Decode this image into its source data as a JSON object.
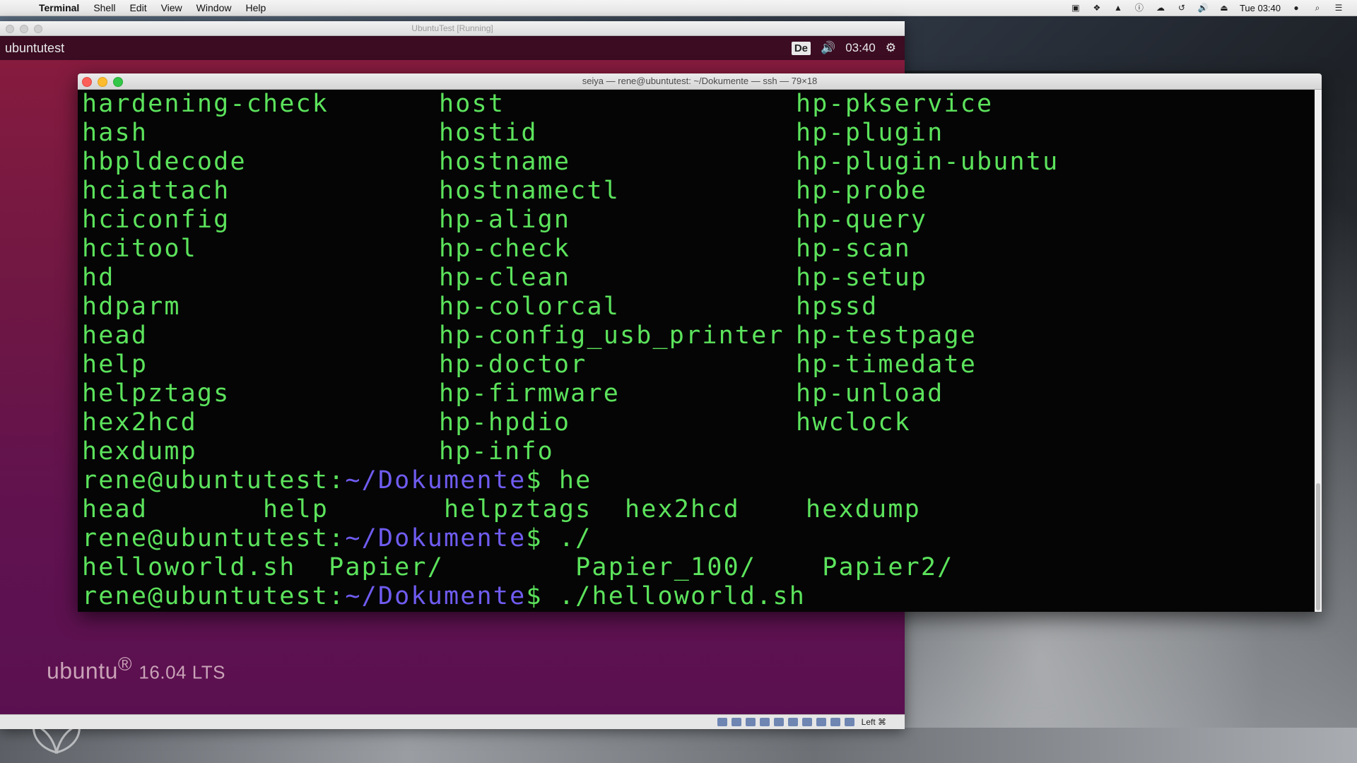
{
  "mac_menubar": {
    "app_name": "Terminal",
    "menus": [
      "Shell",
      "Edit",
      "View",
      "Window",
      "Help"
    ],
    "clock": "Tue 03:40",
    "tray_icons": [
      "screen-record-icon",
      "dropbox-icon",
      "google-drive-icon",
      "info-icon",
      "wifi-icon",
      "time-machine-icon",
      "volume-icon",
      "eject-icon",
      "user-icon",
      "spotlight-icon",
      "notification-center-icon"
    ]
  },
  "vbox": {
    "title": "UbuntuTest [Running]",
    "hostname": "ubuntutest",
    "keyboard_layout": "De",
    "time": "03:40",
    "brand": "ubuntu",
    "brand_mark": "®",
    "version": "16.04 LTS",
    "host_key": "Left ⌘"
  },
  "terminal": {
    "title": "seiya — rene@ubuntutest: ~/Dokumente — ssh — 79×18",
    "columns": [
      [
        "hardening-check",
        "hash",
        "hbpldecode",
        "hciattach",
        "hciconfig",
        "hcitool",
        "hd",
        "hdparm",
        "head",
        "help",
        "helpztags",
        "hex2hcd",
        "hexdump"
      ],
      [
        "host",
        "hostid",
        "hostname",
        "hostnamectl",
        "hp-align",
        "hp-check",
        "hp-clean",
        "hp-colorcal",
        "hp-config_usb_printer",
        "hp-doctor",
        "hp-firmware",
        "hp-hpdio",
        "hp-info"
      ],
      [
        "hp-pkservice",
        "hp-plugin",
        "hp-plugin-ubuntu",
        "hp-probe",
        "hp-query",
        "hp-scan",
        "hp-setup",
        "hpssd",
        "hp-testpage",
        "hp-timedate",
        "hp-unload",
        "hwclock",
        ""
      ]
    ],
    "prompt_user": "rene@ubuntutest",
    "prompt_sep": ":",
    "prompt_path": "~/Dokumente",
    "prompt_dollar": "$",
    "command1": " he",
    "completions1": "head       help       helpztags  hex2hcd    hexdump",
    "command2": " ./",
    "completions2": "helloworld.sh  Papier/        Papier_100/    Papier2/",
    "command3": " ./helloworld.sh"
  }
}
